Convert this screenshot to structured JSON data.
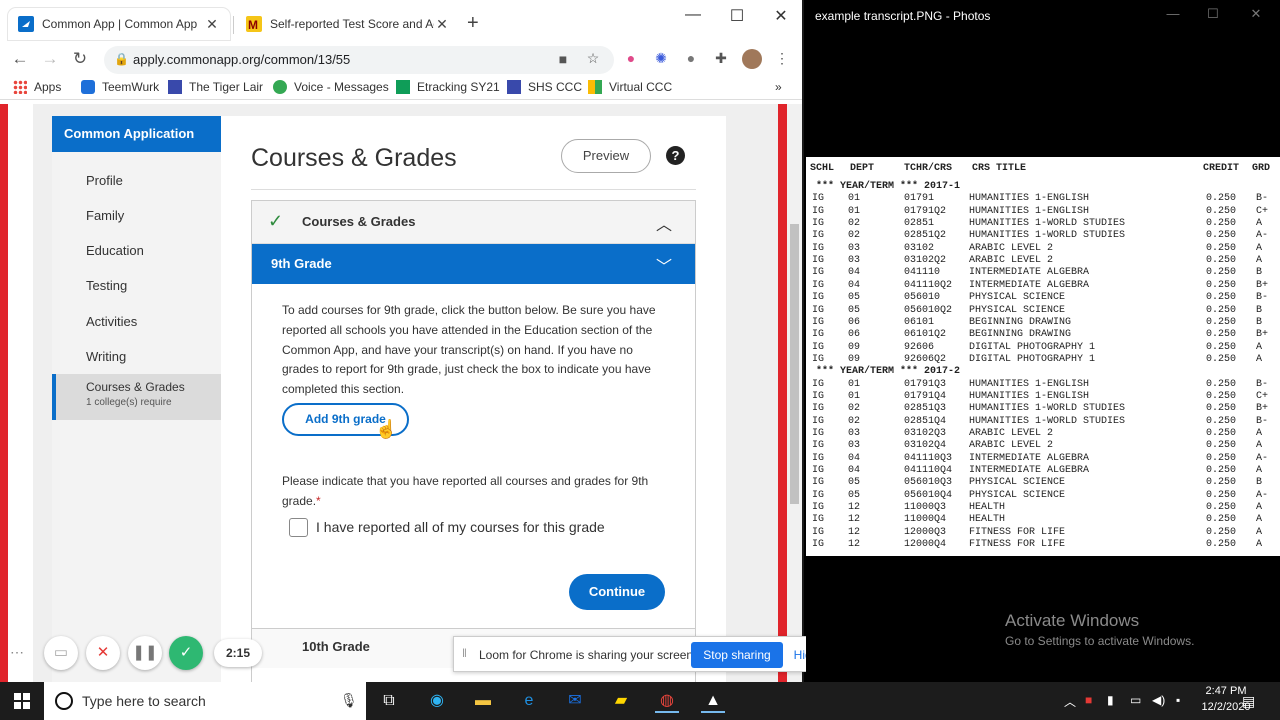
{
  "browser": {
    "tabs": [
      {
        "title": "Common App | Common App",
        "active": true
      },
      {
        "title": "Self-reported Test Score and Aca",
        "active": false
      }
    ],
    "url": "apply.commonapp.org/common/13/55",
    "bookmarks": [
      "Apps",
      "TeemWurk",
      "The Tiger Lair",
      "Voice - Messages",
      "Etracking SY21",
      "SHS CCC",
      "Virtual CCC"
    ],
    "more_bookmarks": "»"
  },
  "sidebar": {
    "header": "Common Application",
    "items": [
      "Profile",
      "Family",
      "Education",
      "Testing",
      "Activities",
      "Writing"
    ],
    "active_item": "Courses & Grades",
    "active_sub": "1 college(s) require"
  },
  "main": {
    "title": "Courses & Grades",
    "preview_label": "Preview",
    "help": "?",
    "section_label": "Courses & Grades",
    "grade_label": "9th Grade",
    "instructions": "To add courses for 9th grade, click the button below. Be sure you have reported all schools you have attended in the Education section of the Common App, and have your transcript(s) on hand. If you have no grades to report for 9th grade, just check the box to indicate you have completed this section.",
    "add_button": "Add 9th grade",
    "indicate_text": "Please indicate that you have reported all courses and grades for 9th grade.",
    "required_mark": "*",
    "checkbox_label": "I have reported all of my courses for this grade",
    "continue_label": "Continue",
    "next_grade": "10th Grade"
  },
  "loom": {
    "timer": "2:15",
    "share_message": "Loom for Chrome is sharing your screen.",
    "stop_label": "Stop sharing",
    "hide_label": "Hide"
  },
  "photos": {
    "title": "example transcript.PNG - Photos",
    "columns": [
      "SCHL",
      "DEPT",
      "TCHR/CRS",
      "CRS TITLE",
      "CREDIT",
      "GRD"
    ],
    "rows": [
      {
        "term": "*** YEAR/TERM *** 2017-1"
      },
      {
        "schl": "IG",
        "dept": "01",
        "crs": "01791",
        "title": "HUMANITIES 1-ENGLISH",
        "credit": "0.250",
        "grd": "B-"
      },
      {
        "schl": "IG",
        "dept": "01",
        "crs": "01791Q2",
        "title": "HUMANITIES 1-ENGLISH",
        "credit": "0.250",
        "grd": "C+"
      },
      {
        "schl": "IG",
        "dept": "02",
        "crs": "02851",
        "title": "HUMANITIES 1-WORLD STUDIES",
        "credit": "0.250",
        "grd": "A"
      },
      {
        "schl": "IG",
        "dept": "02",
        "crs": "02851Q2",
        "title": "HUMANITIES 1-WORLD STUDIES",
        "credit": "0.250",
        "grd": "A-"
      },
      {
        "schl": "IG",
        "dept": "03",
        "crs": "03102",
        "title": "ARABIC LEVEL 2",
        "credit": "0.250",
        "grd": "A"
      },
      {
        "schl": "IG",
        "dept": "03",
        "crs": "03102Q2",
        "title": "ARABIC LEVEL 2",
        "credit": "0.250",
        "grd": "A"
      },
      {
        "schl": "IG",
        "dept": "04",
        "crs": "041110",
        "title": "INTERMEDIATE ALGEBRA",
        "credit": "0.250",
        "grd": "B"
      },
      {
        "schl": "IG",
        "dept": "04",
        "crs": "041110Q2",
        "title": "INTERMEDIATE ALGEBRA",
        "credit": "0.250",
        "grd": "B+"
      },
      {
        "schl": "IG",
        "dept": "05",
        "crs": "056010",
        "title": "PHYSICAL SCIENCE",
        "credit": "0.250",
        "grd": "B-"
      },
      {
        "schl": "IG",
        "dept": "05",
        "crs": "056010Q2",
        "title": "PHYSICAL SCIENCE",
        "credit": "0.250",
        "grd": "B"
      },
      {
        "schl": "IG",
        "dept": "06",
        "crs": "06101",
        "title": "BEGINNING DRAWING",
        "credit": "0.250",
        "grd": "B"
      },
      {
        "schl": "IG",
        "dept": "06",
        "crs": "06101Q2",
        "title": "BEGINNING DRAWING",
        "credit": "0.250",
        "grd": "B+"
      },
      {
        "schl": "IG",
        "dept": "09",
        "crs": "92606",
        "title": "DIGITAL PHOTOGRAPHY 1",
        "credit": "0.250",
        "grd": "A"
      },
      {
        "schl": "IG",
        "dept": "09",
        "crs": "92606Q2",
        "title": "DIGITAL PHOTOGRAPHY 1",
        "credit": "0.250",
        "grd": "A"
      },
      {
        "term": "*** YEAR/TERM *** 2017-2"
      },
      {
        "schl": "IG",
        "dept": "01",
        "crs": "01791Q3",
        "title": "HUMANITIES 1-ENGLISH",
        "credit": "0.250",
        "grd": "B-"
      },
      {
        "schl": "IG",
        "dept": "01",
        "crs": "01791Q4",
        "title": "HUMANITIES 1-ENGLISH",
        "credit": "0.250",
        "grd": "C+"
      },
      {
        "schl": "IG",
        "dept": "02",
        "crs": "02851Q3",
        "title": "HUMANITIES 1-WORLD STUDIES",
        "credit": "0.250",
        "grd": "B+"
      },
      {
        "schl": "IG",
        "dept": "02",
        "crs": "02851Q4",
        "title": "HUMANITIES 1-WORLD STUDIES",
        "credit": "0.250",
        "grd": "B-"
      },
      {
        "schl": "IG",
        "dept": "03",
        "crs": "03102Q3",
        "title": "ARABIC LEVEL 2",
        "credit": "0.250",
        "grd": "A"
      },
      {
        "schl": "IG",
        "dept": "03",
        "crs": "03102Q4",
        "title": "ARABIC LEVEL 2",
        "credit": "0.250",
        "grd": "A"
      },
      {
        "schl": "IG",
        "dept": "04",
        "crs": "041110Q3",
        "title": "INTERMEDIATE ALGEBRA",
        "credit": "0.250",
        "grd": "A-"
      },
      {
        "schl": "IG",
        "dept": "04",
        "crs": "041110Q4",
        "title": "INTERMEDIATE ALGEBRA",
        "credit": "0.250",
        "grd": "A"
      },
      {
        "schl": "IG",
        "dept": "05",
        "crs": "056010Q3",
        "title": "PHYSICAL SCIENCE",
        "credit": "0.250",
        "grd": "B"
      },
      {
        "schl": "IG",
        "dept": "05",
        "crs": "056010Q4",
        "title": "PHYSICAL SCIENCE",
        "credit": "0.250",
        "grd": "A-"
      },
      {
        "schl": "IG",
        "dept": "12",
        "crs": "11000Q3",
        "title": "HEALTH",
        "credit": "0.250",
        "grd": "A"
      },
      {
        "schl": "IG",
        "dept": "12",
        "crs": "11000Q4",
        "title": "HEALTH",
        "credit": "0.250",
        "grd": "A"
      },
      {
        "schl": "IG",
        "dept": "12",
        "crs": "12000Q3",
        "title": "FITNESS FOR LIFE",
        "credit": "0.250",
        "grd": "A"
      },
      {
        "schl": "IG",
        "dept": "12",
        "crs": "12000Q4",
        "title": "FITNESS FOR LIFE",
        "credit": "0.250",
        "grd": "A"
      }
    ],
    "watermark_title": "Activate Windows",
    "watermark_sub": "Go to Settings to activate Windows."
  },
  "taskbar": {
    "search_placeholder": "Type here to search",
    "time": "2:47 PM",
    "date": "12/2/2020"
  },
  "colors": {
    "accent": "#0a6ec9",
    "red_border": "#e0242b",
    "check_green": "#2e8b3d"
  }
}
